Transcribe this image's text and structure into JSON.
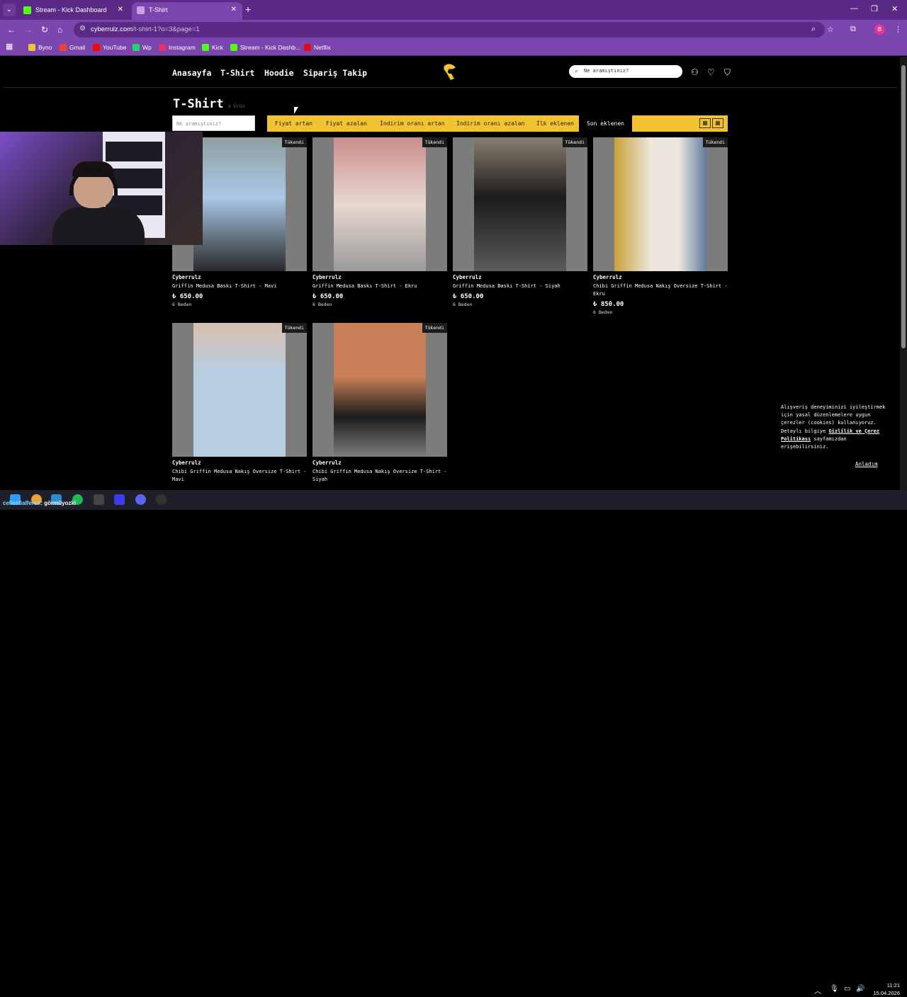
{
  "browser": {
    "tabs": [
      {
        "title": "Stream - Kick Dashboard",
        "active": false,
        "favicon_color": "#53fc18"
      },
      {
        "title": "T-Shirt",
        "active": true,
        "favicon_color": "#c9a0e8"
      }
    ],
    "url_host": "cyberrulz.com",
    "url_path": "/t-shirt-1?o=3&page=1",
    "profile_initial": "B",
    "bookmarks": [
      {
        "label": "Byno",
        "icon_color": "#f0c23a"
      },
      {
        "label": "Gmail",
        "icon_color": "#ea4335"
      },
      {
        "label": "YouTube",
        "icon_color": "#ff0000"
      },
      {
        "label": "Wp",
        "icon_color": "#25d366"
      },
      {
        "label": "Instagram",
        "icon_color": "#e1306c"
      },
      {
        "label": "Kick",
        "icon_color": "#53fc18"
      },
      {
        "label": "Stream - Kick Dashb...",
        "icon_color": "#53fc18"
      },
      {
        "label": "Netflix",
        "icon_color": "#e50914"
      }
    ]
  },
  "site": {
    "nav": [
      "Anasayfa",
      "T-Shirt",
      "Hoodie",
      "Sipariş Takip"
    ],
    "search_placeholder": "Ne aramıştınız?",
    "accent_color": "#f2c230"
  },
  "listing": {
    "title": "T-Shirt",
    "count_label": "6 Ürün",
    "filter_placeholder": "Ne aramıştınız?",
    "sort_options": [
      "Fiyat artan",
      "Fiyat azalan",
      "İndirim oranı artan",
      "İndirim oranı azalan",
      "İlk eklenen",
      "Son eklenen"
    ],
    "selected_sort": "Son eklenen"
  },
  "products": [
    {
      "badge": "Tükendi",
      "brand": "Cyberrulz",
      "name": "Griffin Medusa Baskı T-Shirt - Mavi",
      "price": "₺ 650.00",
      "sizes": "6 Beden",
      "photo_color": "#a9c7e6"
    },
    {
      "badge": "Tükendi",
      "brand": "Cyberrulz",
      "name": "Griffin Medusa Baskı T-Shirt - Ekru",
      "price": "₺ 650.00",
      "sizes": "6 Beden",
      "photo_color": "#c98d8d"
    },
    {
      "badge": "Tükendi",
      "brand": "Cyberrulz",
      "name": "Griffin Medusa Baskı T-Shirt - Siyah",
      "price": "₺ 650.00",
      "sizes": "6 Beden",
      "photo_color": "#6a6258"
    },
    {
      "badge": "Tükendi",
      "brand": "Cyberrulz",
      "name": "Chibi Griffin Medusa Nakış Oversize T-Shirt - Ekru",
      "price": "₺ 850.00",
      "sizes": "6 Beden",
      "photo_color": "#d8b89a"
    },
    {
      "badge": "Tükendi",
      "brand": "Cyberrulz",
      "name": "Chibi Griffin Medusa Nakış Oversize T-Shirt - Mavi",
      "price": "",
      "sizes": "",
      "photo_color": "#b9cde0"
    },
    {
      "badge": "Tükendi",
      "brand": "Cyberrulz",
      "name": "Chibi Griffin Medusa Nakış Oversize T-Shirt - Siyah",
      "price": "",
      "sizes": "",
      "photo_color": "#c97f57"
    }
  ],
  "cookie": {
    "text_before": "Alışveriş deneyiminizi iyileştirmek için yasal düzenlemelere uygun çerezler (cookies) kullanıyoruz. Detaylı bilgiye ",
    "link": "Gizlilik ve Çerez Politikası",
    "text_after": " sayfamızdan erişebilirsiniz.",
    "accept": "Anladım"
  },
  "stream": {
    "user": "cellestialferox",
    "message": ": görmüyozki"
  },
  "clock": {
    "time": "11:21",
    "date": "15.04.2026"
  }
}
